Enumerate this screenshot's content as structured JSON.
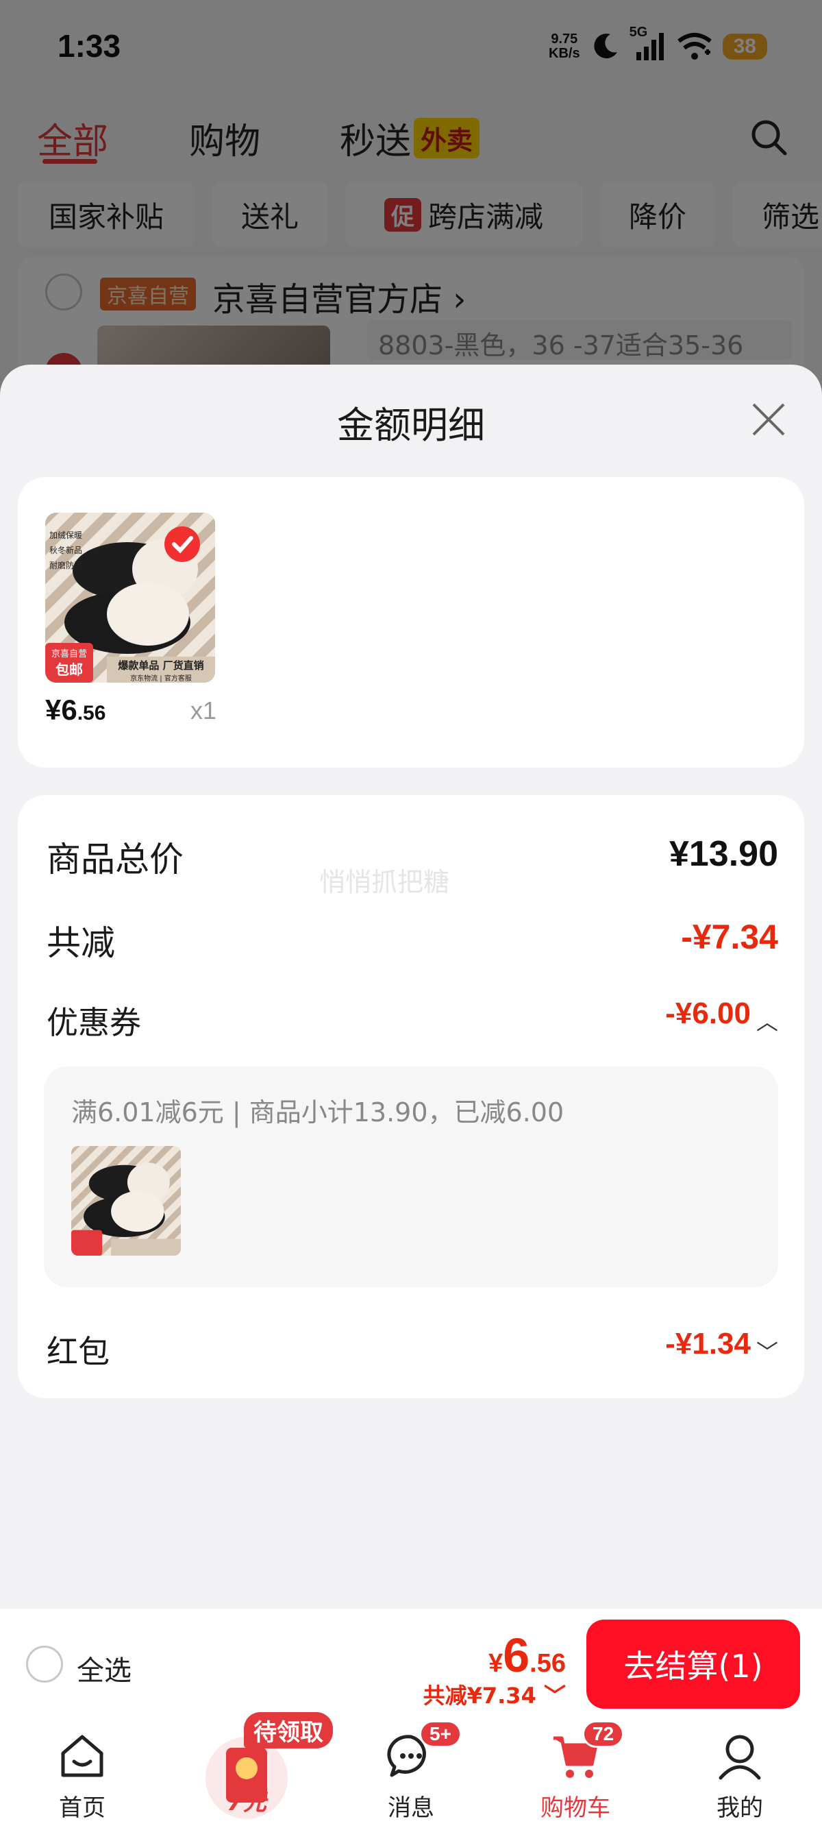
{
  "status_bar": {
    "time": "1:33",
    "net_speed_value": "9.75",
    "net_speed_unit": "KB/s",
    "network": "5G",
    "battery": "38"
  },
  "top_tabs": {
    "all": "全部",
    "shopping": "购物",
    "instant": "秒送",
    "takeout": "外卖"
  },
  "filters": [
    "国家补贴",
    "送礼",
    "跨店满减",
    "降价",
    "筛选"
  ],
  "filter_promo_tag": "促",
  "store": {
    "badge": "京喜自营",
    "name": "京喜自营官方店",
    "spec": "8803-黑色，36 -37适合35-36"
  },
  "sheet": {
    "title": "金额明细",
    "product": {
      "price_int": "¥6",
      "price_dec": ".56",
      "qty": "x1",
      "img_tags": [
        "加绒保暖",
        "秋冬新品",
        "耐磨防滑"
      ],
      "img_corner_top": "京喜自营",
      "img_corner_bottom": "包邮",
      "img_banner": "爆款单品 厂货直销",
      "img_banner_sub": "京东物流  |  官方客服"
    },
    "watermark": "悄悄抓把糖",
    "rows": {
      "total_label": "商品总价",
      "total_value": "¥13.90",
      "discount_label": "共减",
      "discount_value": "-¥7.34",
      "coupon_label": "优惠券",
      "coupon_value": "-¥6.00",
      "coupon_detail": "满6.01减6元 | 商品小计13.90，已减6.00",
      "redpacket_label": "红包",
      "redpacket_value": "-¥1.34"
    }
  },
  "checkout": {
    "select_all": "全选",
    "price_symbol": "¥",
    "price_int": "6",
    "price_dec": ".56",
    "saving": "共减¥7.34",
    "button": "去结算(1)"
  },
  "nav": {
    "home": "首页",
    "redpack_label": "待领取",
    "redpack_amount": "7元",
    "messages": "消息",
    "messages_badge": "5+",
    "cart": "购物车",
    "cart_badge": "72",
    "mine": "我的"
  },
  "colors": {
    "brand_red": "#e4393c",
    "price_red": "#e8290e",
    "checkout_red": "#ff0f23"
  }
}
